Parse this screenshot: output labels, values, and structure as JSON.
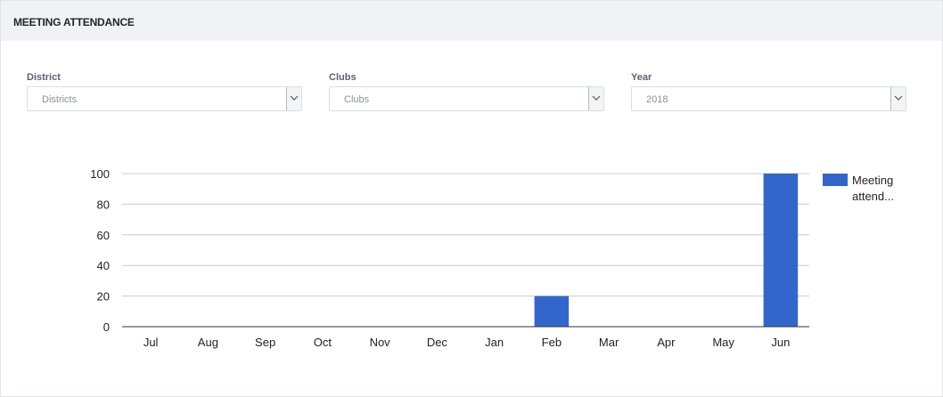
{
  "header": {
    "title": "MEETING ATTENDANCE"
  },
  "filters": [
    {
      "label": "District",
      "value": "Districts"
    },
    {
      "label": "Clubs",
      "value": "Clubs"
    },
    {
      "label": "Year",
      "value": "2018"
    }
  ],
  "colors": {
    "bar": "#3366cc",
    "grid": "#cccccc",
    "axis": "#333333"
  },
  "chart_data": {
    "type": "bar",
    "categories": [
      "Jul",
      "Aug",
      "Sep",
      "Oct",
      "Nov",
      "Dec",
      "Jan",
      "Feb",
      "Mar",
      "Apr",
      "May",
      "Jun"
    ],
    "series": [
      {
        "name": "Meeting attend...",
        "values": [
          0,
          0,
          0,
          0,
          0,
          0,
          0,
          20,
          0,
          0,
          0,
          100
        ]
      }
    ],
    "ylim": [
      0,
      100
    ],
    "yticks": [
      0,
      20,
      40,
      60,
      80,
      100
    ],
    "grid": true,
    "legend": "right"
  }
}
